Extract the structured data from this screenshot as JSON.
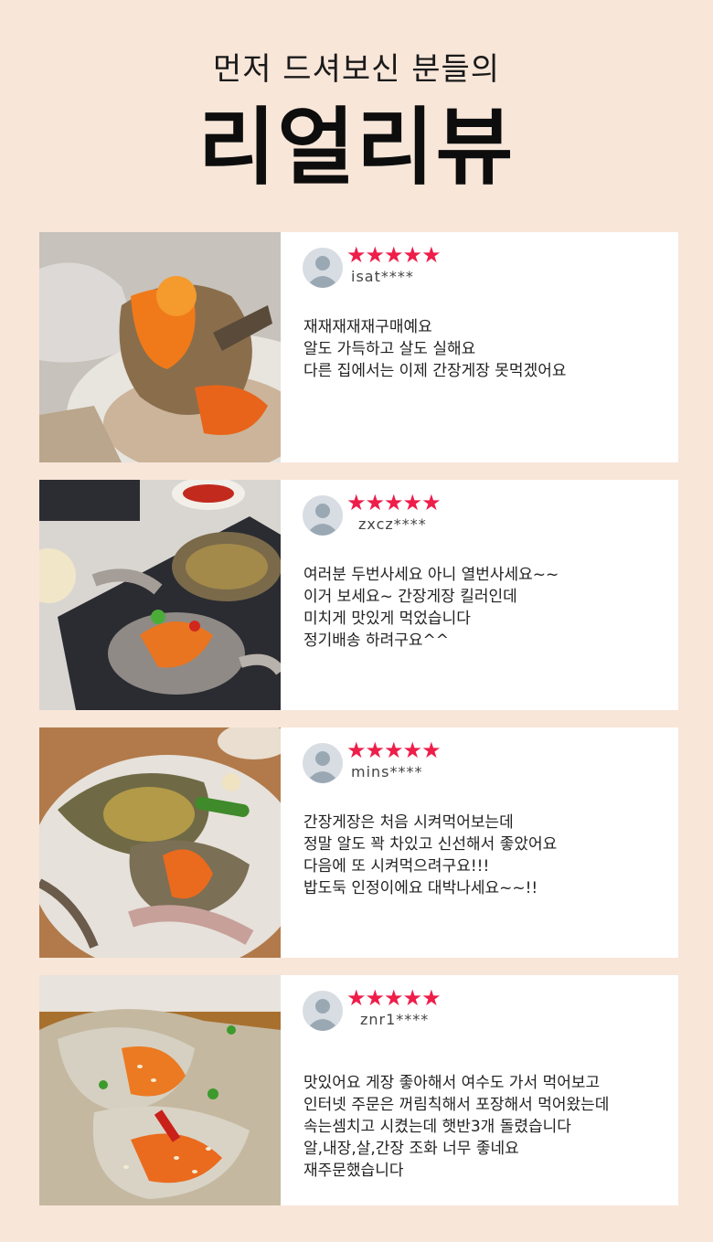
{
  "header": {
    "subtitle": "먼저 드셔보신 분들의",
    "title": "리얼리뷰"
  },
  "colors": {
    "background": "#f8e6d9",
    "star": "#ee1d4a",
    "card": "#ffffff"
  },
  "reviews": [
    {
      "stars": "★★★★★",
      "rating": 5,
      "user": "isat****",
      "lines": [
        "재재재재재구매예요",
        "알도 가득하고 살도 실해요",
        "다른 집에서는 이제 간장게장 못먹겠어요"
      ],
      "photo_icon": "crab-roe-photo"
    },
    {
      "stars": "★★★★★",
      "rating": 5,
      "user": "zxcz****",
      "lines": [
        "여러분 두번사세요 아니 열번사세요~~",
        "이거 보세요~ 간장게장 킬러인데",
        "미치게 맛있게 먹었습니다",
        "정기배송 하려구요^^"
      ],
      "photo_icon": "crab-platter-photo"
    },
    {
      "stars": "★★★★★",
      "rating": 5,
      "user": "mins****",
      "lines": [
        "간장게장은 처음 시켜먹어보는데",
        "정말 알도 꽉 차있고 신선해서 좋았어요",
        "다음에 또 시켜먹으려구요!!!",
        "밥도둑 인정이에요 대박나세요~~!!"
      ],
      "photo_icon": "crab-plate-photo"
    },
    {
      "stars": "★★★★★",
      "rating": 5,
      "user": "znr1****",
      "lines": [
        "맛있어요 게장 좋아해서 여수도 가서 먹어보고",
        "인터넷 주문은 꺼림칙해서 포장해서 먹어왔는데",
        "속는셈치고 시켰는데 햇반3개 돌렸습니다",
        "알,내장,살,간장 조화 너무 좋네요",
        "재주문했습니다"
      ],
      "photo_icon": "crab-sesame-photo"
    }
  ]
}
